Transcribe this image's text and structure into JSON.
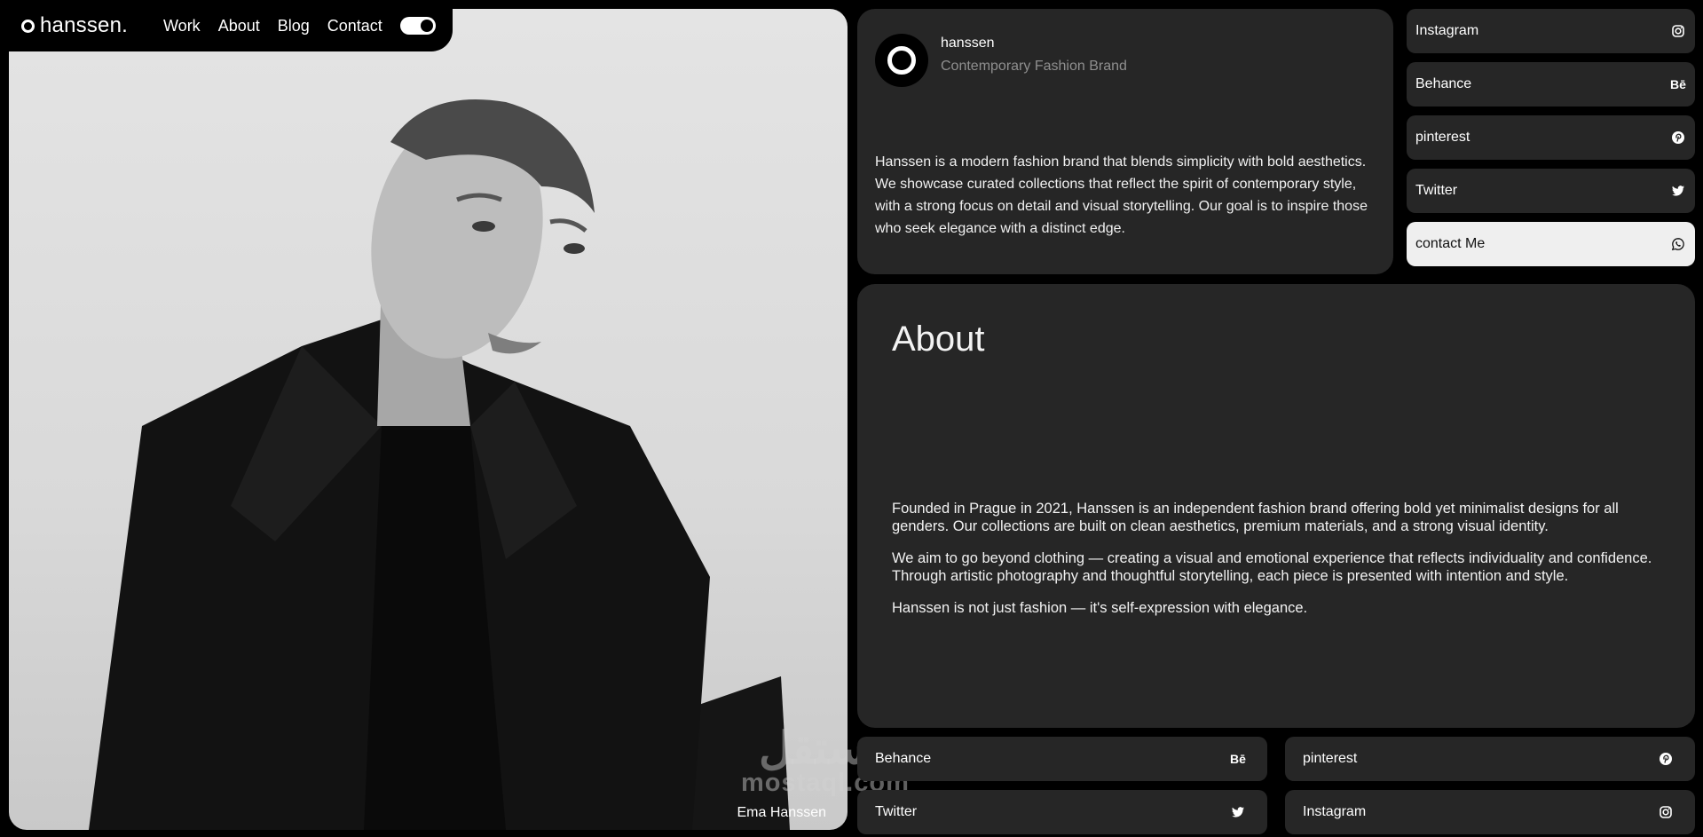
{
  "brand": {
    "name": "hanssen."
  },
  "nav": {
    "items": [
      "Work",
      "About",
      "Blog",
      "Contact"
    ]
  },
  "hero": {
    "caption": "Ema Hanssen"
  },
  "watermark": {
    "arabic": "مستقل",
    "latin": "mostaql.com"
  },
  "profile": {
    "name": "hanssen",
    "subtitle": "Contemporary Fashion Brand",
    "description": "Hanssen is a modern fashion brand that blends simplicity with bold aesthetics. We showcase curated collections that reflect the spirit of contemporary style, with a strong focus on detail and visual storytelling. Our goal is to inspire those who seek elegance with a distinct edge."
  },
  "social": [
    {
      "label": "Instagram",
      "icon": "instagram-icon"
    },
    {
      "label": "Behance",
      "icon": "behance-icon",
      "glyph": "Bē"
    },
    {
      "label": "pinterest",
      "icon": "pinterest-icon"
    },
    {
      "label": "Twitter",
      "icon": "twitter-icon"
    },
    {
      "label": "contact Me",
      "icon": "whatsapp-icon"
    }
  ],
  "about": {
    "title": "About",
    "paragraphs": [
      "Founded in Prague in 2021, Hanssen is an independent fashion brand offering bold yet minimalist designs for all genders. Our collections are built on clean aesthetics, premium materials, and a strong visual identity.",
      "We aim to go beyond clothing — creating a visual and emotional experience that reflects individuality and confidence. Through artistic photography and thoughtful storytelling, each piece is presented with intention and style.",
      "Hanssen is not just fashion — it's self-expression with elegance."
    ]
  },
  "bottom_links": [
    {
      "label": "Behance",
      "icon": "behance-icon",
      "glyph": "Bē"
    },
    {
      "label": "pinterest",
      "icon": "pinterest-icon"
    },
    {
      "label": "Twitter",
      "icon": "twitter-icon"
    },
    {
      "label": "Instagram",
      "icon": "instagram-icon"
    }
  ],
  "colors": {
    "background": "#000000",
    "card": "#262626",
    "accent_light": "#efefef",
    "muted_text": "#8f8f8f"
  }
}
